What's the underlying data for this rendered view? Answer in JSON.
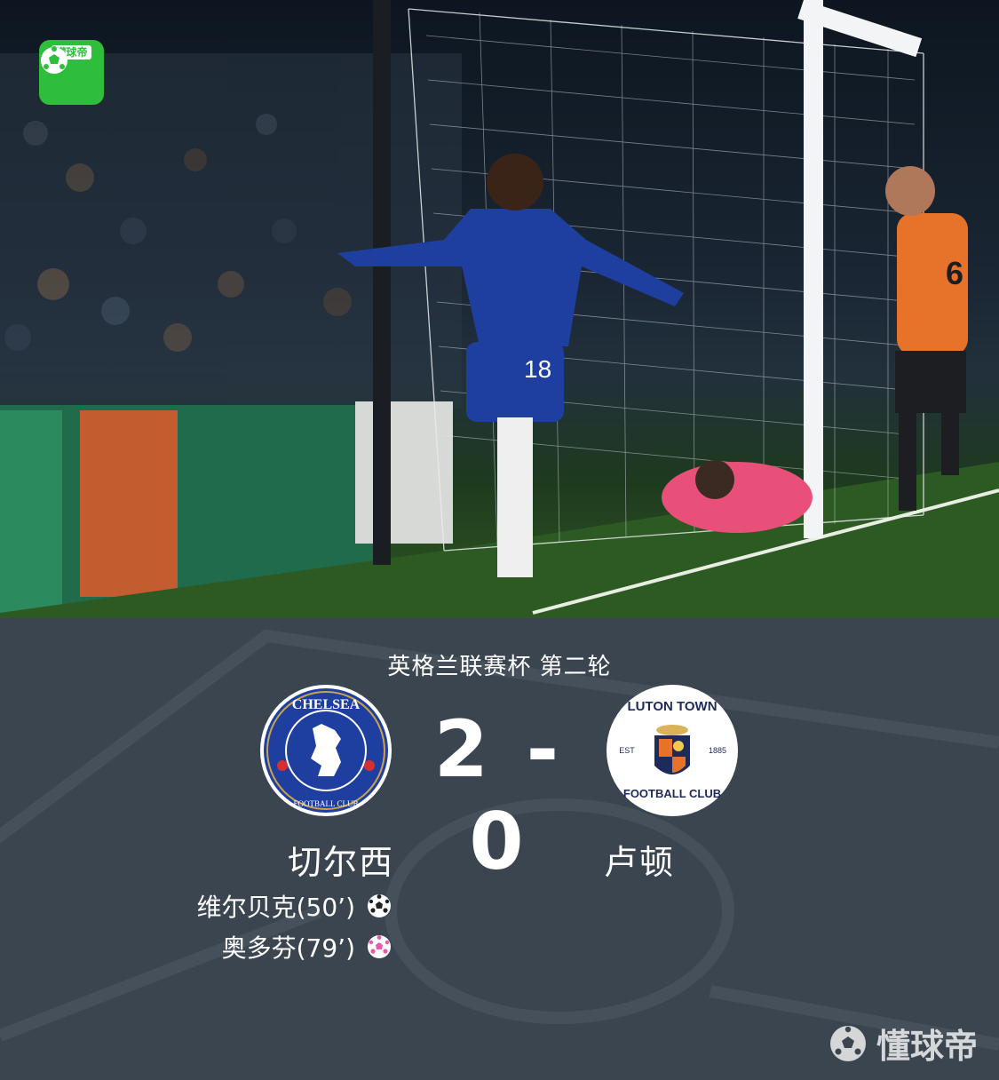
{
  "app": {
    "logo_text": "懂球帝"
  },
  "photo": {
    "jersey_number": "18",
    "luton_number": "6"
  },
  "match": {
    "competition": "英格兰联赛杯 第二轮",
    "score": "2 - 0",
    "home": {
      "name": "切尔西",
      "crest_text": "CHELSEA",
      "crest_sub": "FOOTBALL CLUB"
    },
    "away": {
      "name": "卢顿",
      "crest_text": "LUTON TOWN",
      "crest_sub": "FOOTBALL CLUB",
      "est": "EST",
      "year": "1885"
    },
    "scorers": [
      {
        "label": "维尔贝克(50’)",
        "icon": "soccer-ball-icon",
        "color": "#ffffff"
      },
      {
        "label": "奥多芬(79’)",
        "icon": "soccer-ball-icon",
        "color": "#e85aa8"
      }
    ]
  },
  "watermark": {
    "text": "懂球帝"
  },
  "colors": {
    "panel": "#3b4550",
    "brand_green": "#2fbd3c",
    "chelsea_blue": "#1f3fa0",
    "luton_orange": "#e7722a"
  }
}
